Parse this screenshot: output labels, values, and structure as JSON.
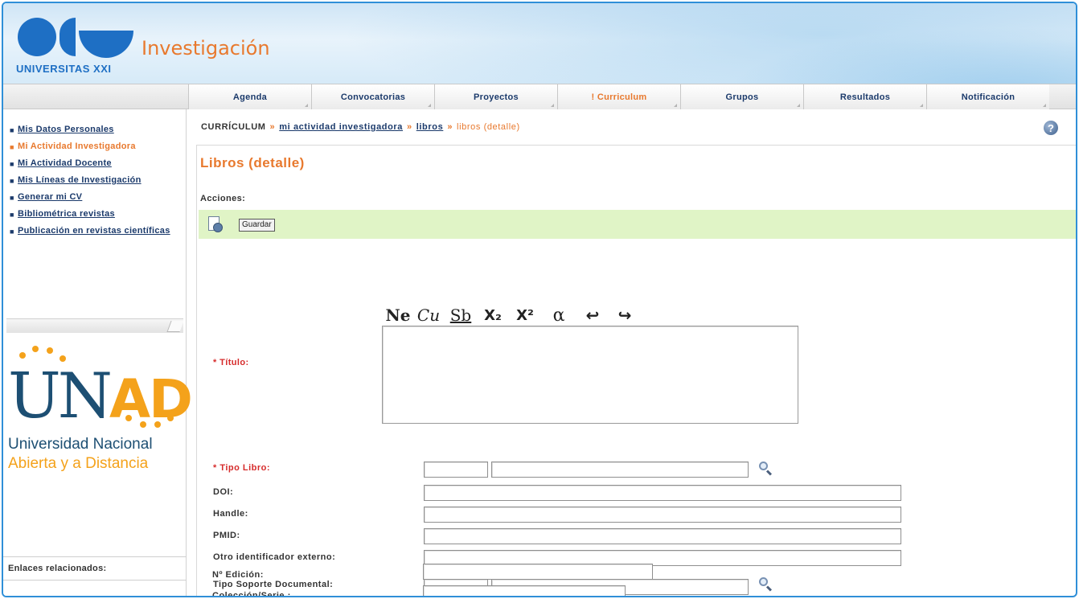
{
  "header": {
    "brand": "UNIVERSITAS XXI",
    "app_title": "Investigación"
  },
  "nav": {
    "tabs": [
      {
        "label": "Agenda"
      },
      {
        "label": "Convocatorias"
      },
      {
        "label": "Proyectos"
      },
      {
        "label": "! Curriculum"
      },
      {
        "label": "Grupos"
      },
      {
        "label": "Resultados"
      },
      {
        "label": "Notificación"
      }
    ],
    "active": "! Curriculum"
  },
  "sidebar": {
    "items": [
      {
        "label": "Mis Datos Personales"
      },
      {
        "label": "Mi Actividad Investigadora"
      },
      {
        "label": "Mi Actividad Docente"
      },
      {
        "label": "Mis Líneas de Investigación"
      },
      {
        "label": "Generar mi CV"
      },
      {
        "label": "Bibliométrica revistas"
      },
      {
        "label": "Publicación en revistas científicas"
      }
    ],
    "active_item": "Mi Actividad Investigadora",
    "institution": {
      "logo_letters_a": "UN",
      "logo_letters_b": "AD",
      "name_line1": "Universidad Nacional",
      "name_line2": "Abierta y a  Distancia"
    },
    "related_links_label": "Enlaces relacionados:"
  },
  "breadcrumb": {
    "root": "CURRÍCULUM",
    "sep": "»",
    "link1": "mi actividad investigadora",
    "link2": "libros",
    "current": "libros (detalle)"
  },
  "page": {
    "title": "Libros (detalle)",
    "actions_label": "Acciones:",
    "save_button": "Guardar"
  },
  "editor": {
    "bold": "Ne",
    "italic": "Cu",
    "underline": "Sb",
    "subscript": "X₂",
    "superscript": "X²",
    "special_char": "α",
    "undo": "↩",
    "redo": "↪"
  },
  "form": {
    "titulo_label": "* Título:",
    "tipo_libro_label": "* Tipo Libro:",
    "doi_label": "DOI:",
    "handle_label": "Handle:",
    "pmid_label": "PMID:",
    "otro_id_label": "Otro identificador externo:",
    "tipo_soporte_label": "Tipo Soporte Documental:",
    "edicion_label": "Nº Edición:",
    "coleccion_label": "Colección/Serie :"
  },
  "colors": {
    "accent": "#e8792e",
    "link": "#1b3a6b",
    "required": "#d62b2b",
    "action_bar": "#e0f4c6",
    "frame": "#2f8fd8"
  },
  "icons": {
    "help": "help-icon",
    "save": "save-icon",
    "lookup": "magnifier-icon"
  }
}
